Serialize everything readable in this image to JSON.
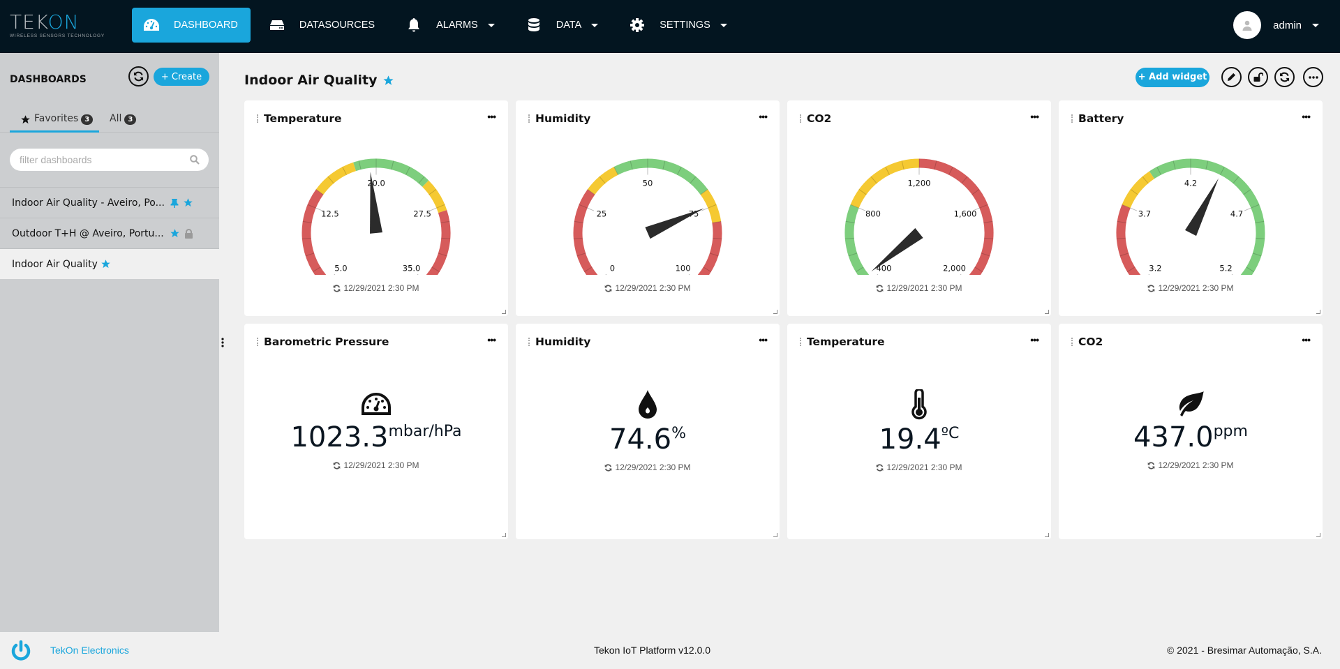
{
  "brand": {
    "name_main": "TEK",
    "name_accent": "ON",
    "tagline": "WIRELESS SENSORS TECHNOLOGY",
    "accent_color": "#1aa6dc",
    "nav_bg": "#031520"
  },
  "nav": {
    "items": [
      {
        "label": "DASHBOARD",
        "icon": "dashboard-gauge-icon",
        "active": true,
        "dropdown": false
      },
      {
        "label": "DATASOURCES",
        "icon": "hdd-icon",
        "active": false,
        "dropdown": false
      },
      {
        "label": "ALARMS",
        "icon": "bell-icon",
        "active": false,
        "dropdown": true
      },
      {
        "label": "DATA",
        "icon": "database-icon",
        "active": false,
        "dropdown": true
      },
      {
        "label": "SETTINGS",
        "icon": "gear-icon",
        "active": false,
        "dropdown": true
      }
    ],
    "user": {
      "name": "admin"
    }
  },
  "sidebar": {
    "title": "DASHBOARDS",
    "create_label": "+ Create",
    "tabs": [
      {
        "label": "Favorites",
        "count": "3",
        "active": true
      },
      {
        "label": "All",
        "count": "3",
        "active": false
      }
    ],
    "filter_placeholder": "filter dashboards",
    "items": [
      {
        "label": "Indoor Air Quality - Aveiro, Po...",
        "pinned": true,
        "favorite": true,
        "locked": false,
        "selected": false
      },
      {
        "label": "Outdoor T+H @ Aveiro, Portu...",
        "pinned": false,
        "favorite": true,
        "locked": true,
        "selected": false
      },
      {
        "label": "Indoor Air Quality",
        "pinned": false,
        "favorite": true,
        "locked": false,
        "selected": true
      }
    ]
  },
  "dashboard": {
    "title": "Indoor Air Quality",
    "favorite": true,
    "toolbar": {
      "add_widget_label": "+ Add widget"
    },
    "gauges": [
      {
        "title": "Temperature",
        "value": 19.4,
        "display": "19.4ºC",
        "min": 5.0,
        "max": 35.0,
        "ticks": [
          "5.0",
          "12.5",
          "20.0",
          "27.5",
          "35.0"
        ],
        "bands": [
          {
            "from": 5,
            "to": 14,
            "color": "#d65b5b"
          },
          {
            "from": 14,
            "to": 18,
            "color": "#f5c932"
          },
          {
            "from": 18,
            "to": 25,
            "color": "#7dce7d"
          },
          {
            "from": 25,
            "to": 28,
            "color": "#f5c932"
          },
          {
            "from": 28,
            "to": 35,
            "color": "#d65b5b"
          }
        ],
        "timestamp": "12/29/2021 2:30 PM"
      },
      {
        "title": "Humidity",
        "value": 74.6,
        "display": "74.6%",
        "min": 0,
        "max": 100,
        "ticks": [
          "0",
          "25",
          "50",
          "75",
          "100"
        ],
        "bands": [
          {
            "from": 0,
            "to": 30,
            "color": "#d65b5b"
          },
          {
            "from": 30,
            "to": 40,
            "color": "#f5c932"
          },
          {
            "from": 40,
            "to": 70,
            "color": "#7dce7d"
          },
          {
            "from": 70,
            "to": 80,
            "color": "#f5c932"
          },
          {
            "from": 80,
            "to": 100,
            "color": "#d65b5b"
          }
        ],
        "timestamp": "12/29/2021 2:30 PM"
      },
      {
        "title": "CO2",
        "value": 437,
        "display": "437ppm",
        "min": 400,
        "max": 2000,
        "ticks": [
          "400",
          "800",
          "1,200",
          "1,600",
          "2,000"
        ],
        "bands": [
          {
            "from": 400,
            "to": 800,
            "color": "#7dce7d"
          },
          {
            "from": 800,
            "to": 1200,
            "color": "#f5c932"
          },
          {
            "from": 1200,
            "to": 2000,
            "color": "#d65b5b"
          }
        ],
        "timestamp": "12/29/2021 2:30 PM"
      },
      {
        "title": "Battery",
        "value": 4.4,
        "display": "4.4V",
        "min": 3.2,
        "max": 5.2,
        "ticks": [
          "3.2",
          "3.7",
          "4.2",
          "4.7",
          "5.2"
        ],
        "bands": [
          {
            "from": 3.2,
            "to": 3.7,
            "color": "#d65b5b"
          },
          {
            "from": 3.7,
            "to": 3.95,
            "color": "#f5c932"
          },
          {
            "from": 3.95,
            "to": 5.2,
            "color": "#7dce7d"
          }
        ],
        "timestamp": "12/29/2021 2:30 PM"
      }
    ],
    "cards": [
      {
        "title": "Barometric Pressure",
        "icon": "gauge-icon",
        "value": "1023.3",
        "unit": "mbar/hPa",
        "timestamp": "12/29/2021 2:30 PM"
      },
      {
        "title": "Humidity",
        "icon": "droplet-icon",
        "value": "74.6",
        "unit": "%",
        "timestamp": "12/29/2021 2:30 PM"
      },
      {
        "title": "Temperature",
        "icon": "thermometer-icon",
        "value": "19.4",
        "unit": "ºC",
        "timestamp": "12/29/2021 2:30 PM"
      },
      {
        "title": "CO2",
        "icon": "leaf-icon",
        "value": "437.0",
        "unit": "ppm",
        "timestamp": "12/29/2021 2:30 PM"
      }
    ]
  },
  "footer": {
    "company": "TekOn Electronics",
    "version": "Tekon IoT Platform v12.0.0",
    "copyright": "© 2021 - Bresimar Automação, S.A."
  }
}
